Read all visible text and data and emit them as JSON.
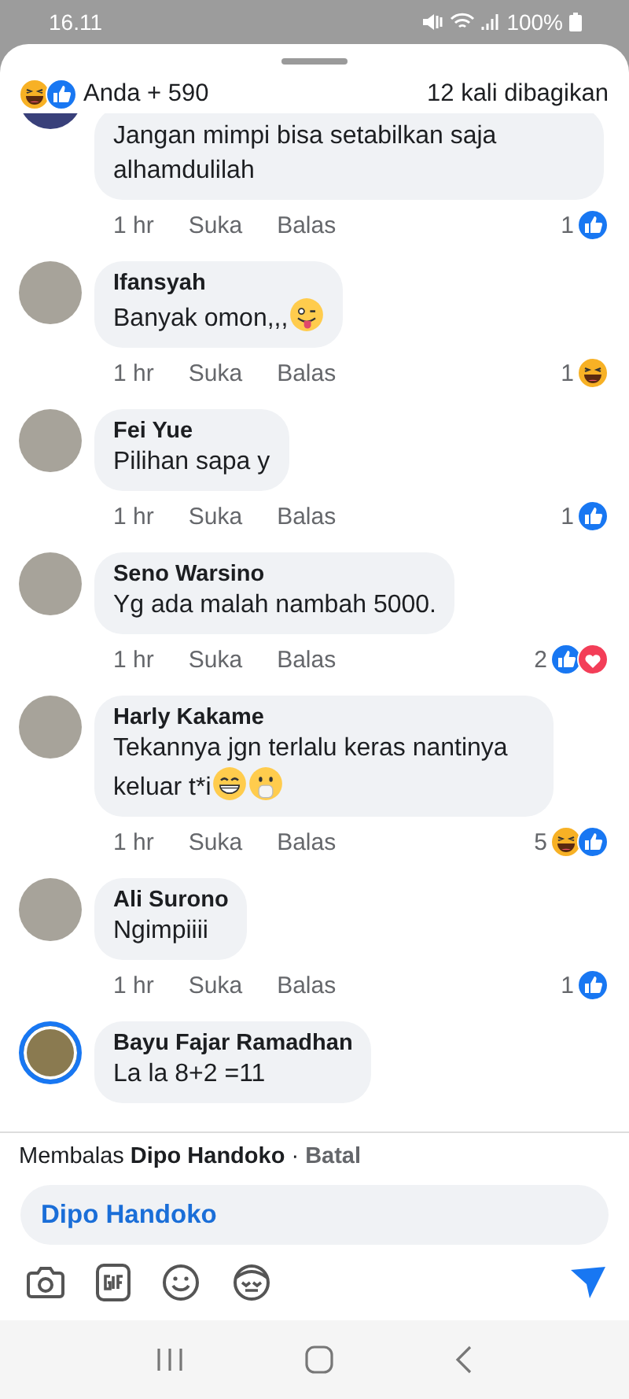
{
  "status_bar": {
    "time": "16.11",
    "battery": "100%"
  },
  "header": {
    "reactions": [
      {
        "kind": "haha"
      },
      {
        "kind": "like"
      }
    ],
    "reactors": "Anda + 590",
    "shares": "12 kali dibagikan"
  },
  "comments": [
    {
      "text": "Jangan mimpi bisa setabilkan saja alhamdulilah",
      "time": "1 hr",
      "like": "Suka",
      "reply": "Balas",
      "reaction_count": "1",
      "reactions": [
        {
          "kind": "like"
        }
      ],
      "avatar_ring": false
    },
    {
      "name": "Ifansyah",
      "text": "Banyak omon,,,",
      "emojis": [
        {
          "kind": "tongue"
        }
      ],
      "time": "1 hr",
      "like": "Suka",
      "reply": "Balas",
      "reaction_count": "1",
      "reactions": [
        {
          "kind": "haha"
        }
      ],
      "avatar_ring": false
    },
    {
      "name": "Fei Yue",
      "text": "Pilihan sapa y",
      "time": "1 hr",
      "like": "Suka",
      "reply": "Balas",
      "reaction_count": "1",
      "reactions": [
        {
          "kind": "like"
        }
      ],
      "avatar_ring": false
    },
    {
      "name": "Seno Warsino",
      "text": "Yg ada malah nambah 5000.",
      "time": "1 hr",
      "like": "Suka",
      "reply": "Balas",
      "reaction_count": "2",
      "reactions": [
        {
          "kind": "like"
        },
        {
          "kind": "love"
        }
      ],
      "avatar_ring": false
    },
    {
      "name": "Harly Kakame",
      "text": "Tekannya jgn terlalu keras nantinya keluar t*i",
      "emojis": [
        {
          "kind": "grin"
        },
        {
          "kind": "hand-over-mouth"
        }
      ],
      "time": "1 hr",
      "like": "Suka",
      "reply": "Balas",
      "reaction_count": "5",
      "reactions": [
        {
          "kind": "haha"
        },
        {
          "kind": "like"
        }
      ],
      "avatar_ring": false
    },
    {
      "name": "Ali Surono",
      "text": "Ngimpiiii",
      "time": "1 hr",
      "like": "Suka",
      "reply": "Balas",
      "reaction_count": "1",
      "reactions": [
        {
          "kind": "like"
        }
      ],
      "avatar_ring": false
    },
    {
      "name": "Bayu Fajar Ramadhan",
      "text": "La la  8+2 =11",
      "avatar_ring": true
    }
  ],
  "reply_bar": {
    "text": "Membalas **Dipo Handoko** ·",
    "cancel": "Batal"
  },
  "composer": {
    "value": "Dipo Handoko"
  }
}
